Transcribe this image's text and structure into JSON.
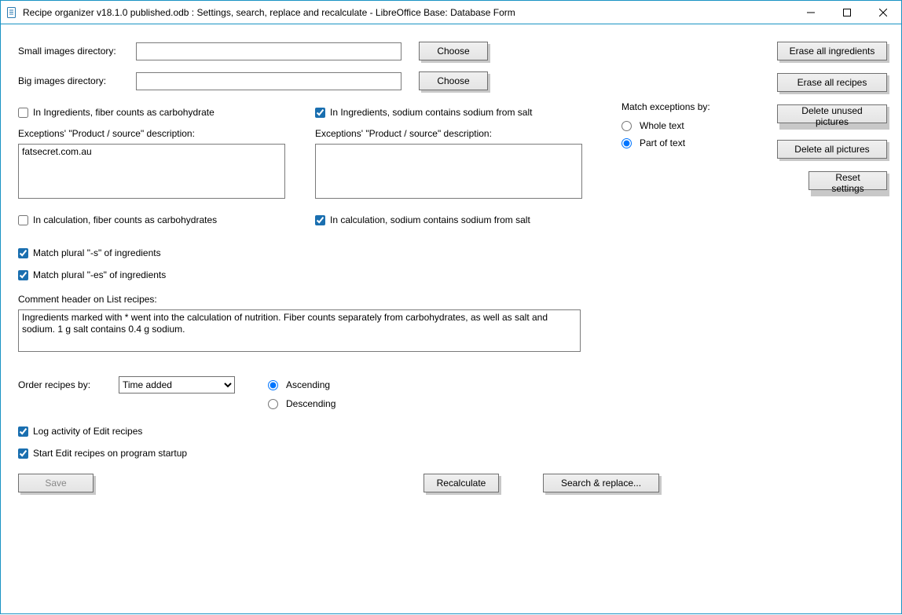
{
  "window": {
    "title": "Recipe organizer v18.1.0 published.odb : Settings, search, replace and recalculate - LibreOffice Base: Database Form"
  },
  "labels": {
    "small_images_dir": "Small images directory:",
    "big_images_dir": "Big images directory:",
    "choose": "Choose",
    "fiber_carb_check": "In Ingredients, fiber counts as carbohydrate",
    "sodium_salt_check": "In Ingredients, sodium contains sodium from salt",
    "exceptions_desc": "Exceptions' \"Product / source\" description:",
    "calc_fiber": "In calculation, fiber counts as carbohydrates",
    "calc_sodium": "In calculation, sodium contains sodium from salt",
    "match_s": "Match plural \"-s\" of ingredients",
    "match_es": "Match plural \"-es\" of ingredients",
    "comment_header": "Comment header on List recipes:",
    "order_by": "Order recipes by:",
    "ascending": "Ascending",
    "descending": "Descending",
    "log_activity": "Log activity of Edit recipes",
    "start_on_startup": "Start Edit recipes on program startup",
    "match_exceptions": "Match exceptions by:",
    "whole_text": "Whole text",
    "part_of_text": "Part of text"
  },
  "values": {
    "small_images_dir": "",
    "big_images_dir": "",
    "exceptions_left": "fatsecret.com.au",
    "exceptions_right": "",
    "comment_text": "Ingredients marked with * went into the calculation of nutrition. Fiber counts separately from carbohydrates, as well as salt and sodium. 1 g salt contains 0.4 g sodium.",
    "order_selected": "Time added"
  },
  "order_options": [
    "Time added"
  ],
  "buttons": {
    "save": "Save",
    "recalculate": "Recalculate",
    "search_replace": "Search & replace...",
    "erase_ingredients": "Erase all ingredients",
    "erase_recipes": "Erase all recipes",
    "delete_unused": "Delete unused pictures",
    "delete_all": "Delete all pictures",
    "reset": "Reset settings"
  }
}
